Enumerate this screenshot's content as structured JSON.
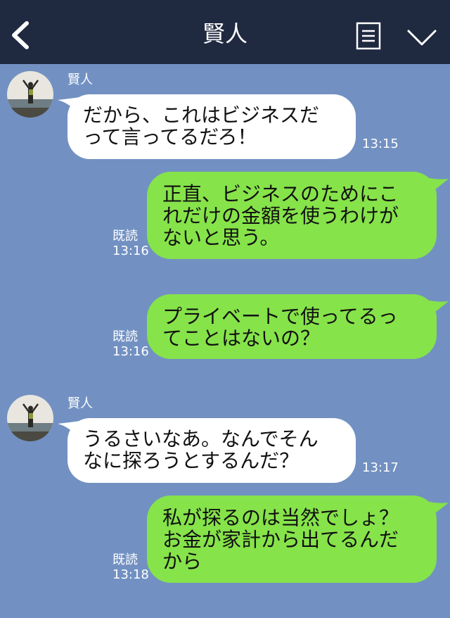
{
  "header": {
    "title": "賢人"
  },
  "icons": {
    "back": "back-chevron-icon",
    "memo": "memo-list-icon",
    "menu": "chevron-down-icon"
  },
  "colors": {
    "background": "#7291c2",
    "header": "#1f2940",
    "incoming": "#ffffff",
    "outgoing": "#86e34a"
  },
  "messages": [
    {
      "direction": "incoming",
      "sender": "賢人",
      "text": "だから、これはビジネスだ\nって言ってるだろ！",
      "time": "13:15"
    },
    {
      "direction": "outgoing",
      "read": "既読",
      "text": "正直、ビジネスのためにこ\nれだけの金額を使うわけが\nないと思う。",
      "time": "13:16"
    },
    {
      "direction": "outgoing",
      "read": "既読",
      "text": "プライベートで使ってるっ\nてことはないの？",
      "time": "13:16"
    },
    {
      "direction": "incoming",
      "sender": "賢人",
      "text": "うるさいなあ。なんでそん\nなに探ろうとするんだ？",
      "time": "13:17"
    },
    {
      "direction": "outgoing",
      "read": "既読",
      "text": "私が探るのは当然でしょ？\nお金が家計から出てるんだ\nから",
      "time": "13:18"
    }
  ]
}
